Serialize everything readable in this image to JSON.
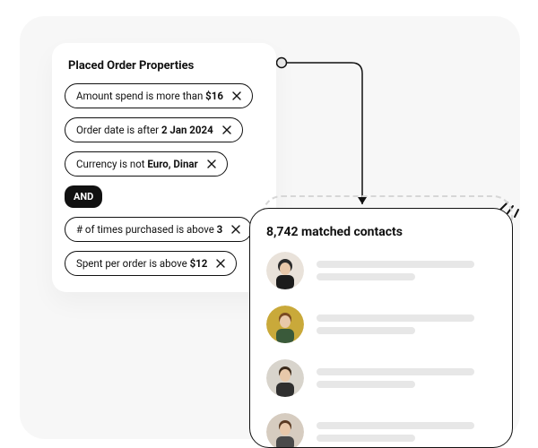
{
  "filter": {
    "title": "Placed Order Properties",
    "chips": [
      {
        "pre": "Amount spend is more than ",
        "bold": "$16"
      },
      {
        "pre": "Order date is after ",
        "bold": "2 Jan 2024"
      },
      {
        "pre": "Currency is not ",
        "bold": "Euro, Dinar"
      }
    ],
    "operator": "AND",
    "chips2": [
      {
        "pre": "# of times purchased is above ",
        "bold": "3"
      },
      {
        "pre": "Spent per order is above ",
        "bold": "$12"
      }
    ]
  },
  "contacts": {
    "title": "8,742 matched contacts"
  }
}
